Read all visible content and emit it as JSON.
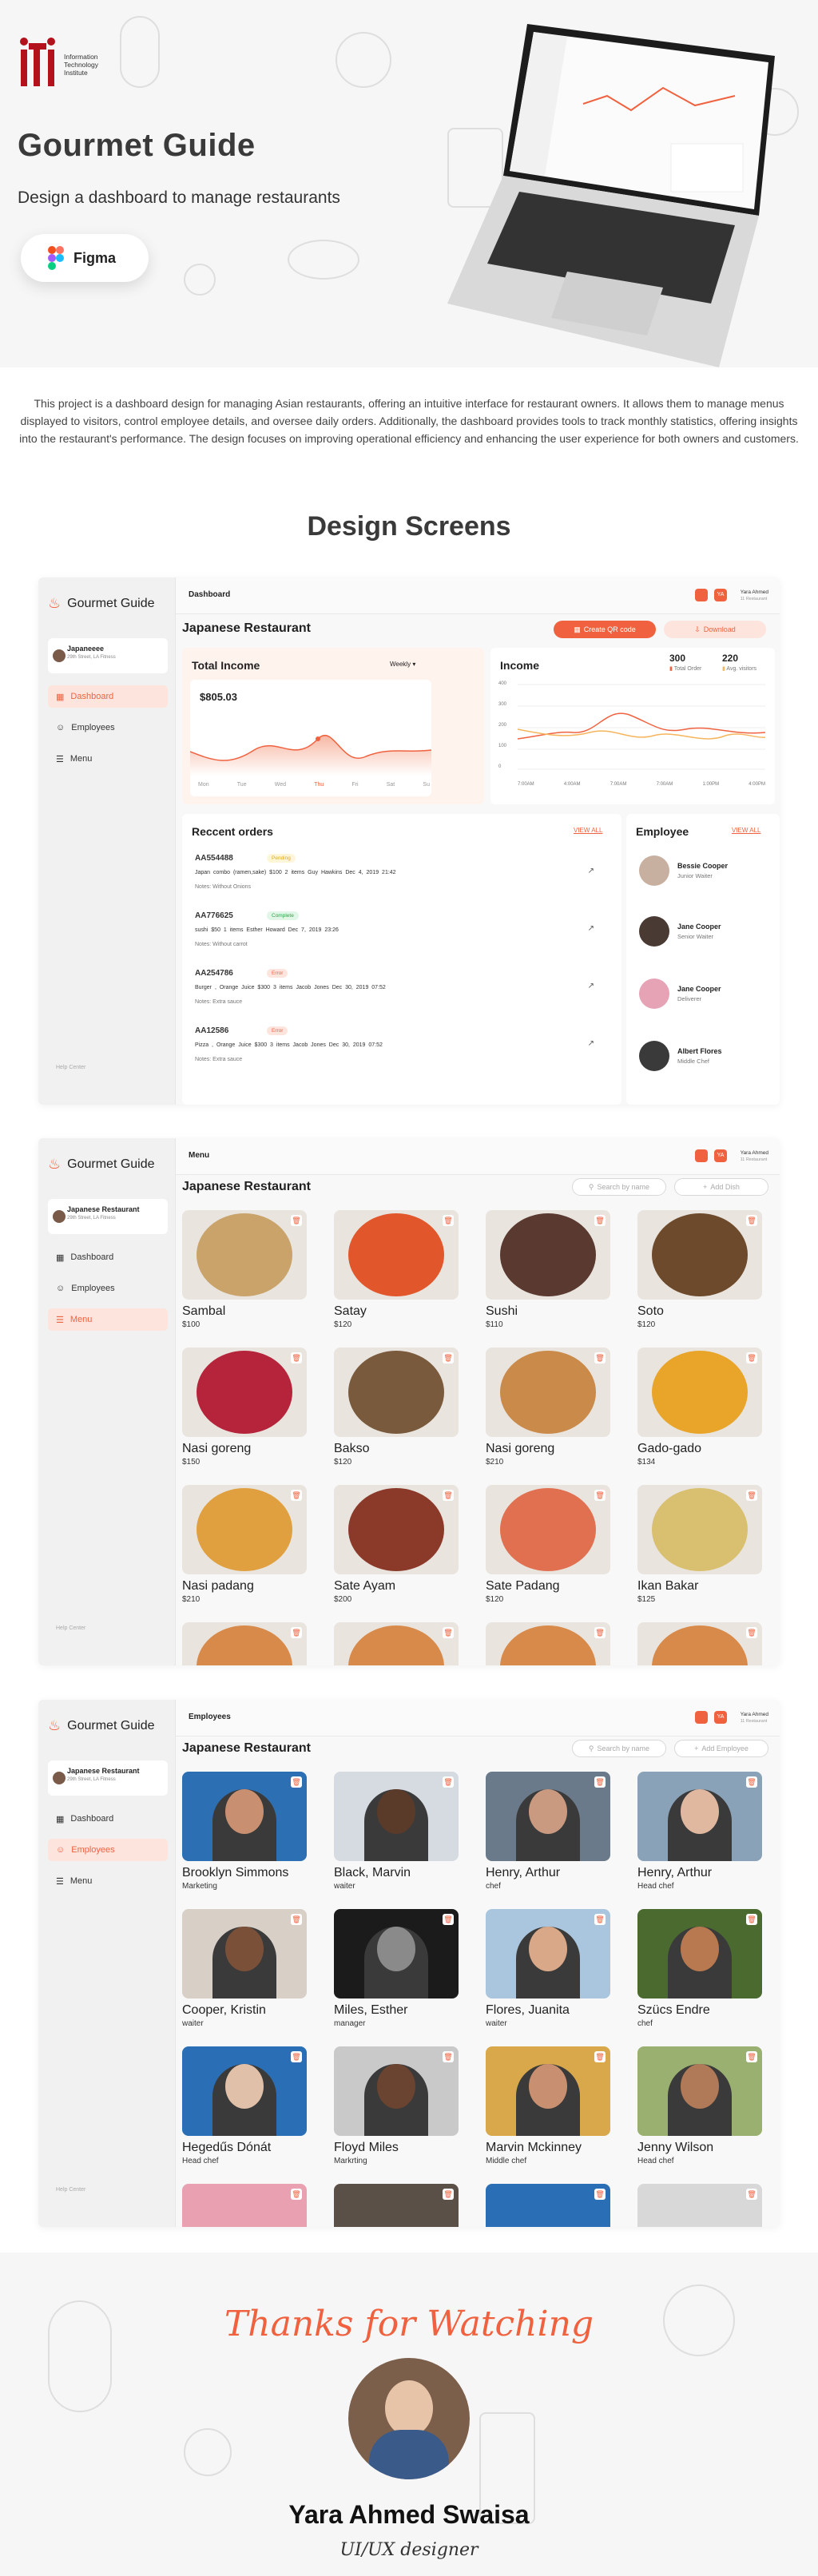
{
  "hero": {
    "logo_text": [
      "Information",
      "Technology",
      "Institute"
    ],
    "title": "Gourmet Guide",
    "subtitle": "Design a dashboard to manage restaurants",
    "tool": "Figma",
    "description": "This project is a dashboard design for managing Asian restaurants, offering an intuitive interface for restaurant owners. It allows them to manage menus displayed to visitors, control employee details, and oversee daily orders. Additionally, the dashboard provides tools to track monthly statistics, offering insights into the restaurant's performance. The design focuses on improving operational efficiency and enhancing the user experience for both owners and customers."
  },
  "section_title": "Design Screens",
  "colors": {
    "accent": "#f0623f",
    "accent_soft": "#fde4dd",
    "bg": "#f8f8f8"
  },
  "app": {
    "brand": "Gourmet Guide",
    "user": {
      "name": "Yara Ahmed",
      "sub": "11 Restaurant",
      "initials": "YA"
    },
    "help": "Help Center",
    "nav": {
      "dashboard": "Dashboard",
      "employees": "Employees",
      "menu": "Menu"
    },
    "restaurant": "Japanese Restaurant"
  },
  "dashboard": {
    "page": "Dashboard",
    "sidebar_rest": "Japaneeee",
    "sidebar_rest_sub": "29th Street, LA Fitness",
    "create_qr": "Create QR code",
    "download": "Download",
    "total_income": {
      "title": "Total Income",
      "period": "Weekly",
      "value": "$805.03",
      "days": [
        "Mon",
        "Tue",
        "Wed",
        "Thu",
        "Fri",
        "Sat",
        "Su"
      ]
    },
    "income": {
      "title": "Income",
      "total_order": "300",
      "total_order_label": "Total Order",
      "avg": "220",
      "avg_label": "Avg. visitors",
      "y_ticks": [
        "400",
        "300",
        "200",
        "100",
        "0"
      ],
      "x_ticks": [
        "7:00AM",
        "4:00AM",
        "7:00AM",
        "7:00AM",
        "1:00PM",
        "4:00PM"
      ]
    },
    "recent_orders": {
      "title": "Reccent orders",
      "view_all": "VIEW ALL",
      "items": [
        {
          "id": "AA554488",
          "status": "Pending",
          "line": "Japan combo (ramen,sake)   $100   2 items   Guy Hawkins        Dec 4, 2019 21:42",
          "note": "Notes: Without Onions"
        },
        {
          "id": "AA776625",
          "status": "Complete",
          "line": "sushi   $50   1 items   Esther Howard        Dec 7, 2019 23:26",
          "note": "Notes: Without carrot"
        },
        {
          "id": "AA254786",
          "status": "Error",
          "line": "Burger , Orange Juice   $300   3 items   Jacob Jones        Dec 30, 2019 07:52",
          "note": "Notes: Extra sauce"
        },
        {
          "id": "AA12586",
          "status": "Error",
          "line": "Pizza , Orange Juice   $300   3 items   Jacob Jones        Dec 30, 2019 07:52",
          "note": "Notes: Extra sauce"
        }
      ]
    },
    "employee": {
      "title": "Employee",
      "view_all": "VIEW ALL",
      "items": [
        {
          "name": "Bessie Cooper",
          "role": "Junior Waiter"
        },
        {
          "name": "Jane Cooper",
          "role": "Senior Waiter"
        },
        {
          "name": "Jane Cooper",
          "role": "Deliverer"
        },
        {
          "name": "Albert Flores",
          "role": "Middle Chef"
        }
      ]
    }
  },
  "menu_screen": {
    "page": "Menu",
    "sidebar_rest": "Japanese Restaurant",
    "sidebar_rest_sub": "29th Street, LA Fitness",
    "search": "Search by name",
    "add": "Add Dish",
    "dishes": [
      {
        "name": "Sambal",
        "price": "$100",
        "color": "#c9a36a"
      },
      {
        "name": "Satay",
        "price": "$120",
        "color": "#e2562b"
      },
      {
        "name": "Sushi",
        "price": "$110",
        "color": "#5a3a30"
      },
      {
        "name": "Soto",
        "price": "$120",
        "color": "#6d4a2c"
      },
      {
        "name": "Nasi goreng",
        "price": "$150",
        "color": "#b5243a"
      },
      {
        "name": "Bakso",
        "price": "$120",
        "color": "#7a5a3d"
      },
      {
        "name": "Nasi goreng",
        "price": "$210",
        "color": "#c98a4a"
      },
      {
        "name": "Gado-gado",
        "price": "$134",
        "color": "#e8a52a"
      },
      {
        "name": "Nasi padang",
        "price": "$210",
        "color": "#e0a040"
      },
      {
        "name": "Sate Ayam",
        "price": "$200",
        "color": "#8b3a2a"
      },
      {
        "name": "Sate Padang",
        "price": "$120",
        "color": "#e07050"
      },
      {
        "name": "Ikan Bakar",
        "price": "$125",
        "color": "#d9c070"
      }
    ]
  },
  "employees_screen": {
    "page": "Employees",
    "sidebar_rest": "Japanese Restaurant",
    "sidebar_rest_sub": "29th Street, LA Fitness",
    "search": "Search by name",
    "add": "Add Employee",
    "people": [
      {
        "name": "Brooklyn Simmons",
        "role": "Marketing",
        "bg": "#2d6fb3",
        "skin": "#c89070"
      },
      {
        "name": "Black, Marvin",
        "role": "waiter",
        "bg": "#d6dbe2",
        "skin": "#5a3a28"
      },
      {
        "name": "Henry, Arthur",
        "role": "chef",
        "bg": "#6b7a8a",
        "skin": "#c99a80"
      },
      {
        "name": "Henry, Arthur",
        "role": "Head chef",
        "bg": "#8aa2b8",
        "skin": "#e0b8a0"
      },
      {
        "name": "Cooper, Kristin",
        "role": "waiter",
        "bg": "#d8cfc6",
        "skin": "#7a5038"
      },
      {
        "name": "Miles, Esther",
        "role": "manager",
        "bg": "#1b1b1b",
        "skin": "#8a8a8a"
      },
      {
        "name": "Flores, Juanita",
        "role": "waiter",
        "bg": "#a9c6de",
        "skin": "#d8a888"
      },
      {
        "name": "Szücs Endre",
        "role": "chef",
        "bg": "#4a6a30",
        "skin": "#b87850"
      },
      {
        "name": "Hegedűs Dónát",
        "role": "Head chef",
        "bg": "#2a6fb5",
        "skin": "#e0c0a8"
      },
      {
        "name": "Floyd Miles",
        "role": "Markrting",
        "bg": "#c9c9c9",
        "skin": "#6a4430"
      },
      {
        "name": "Marvin Mckinney",
        "role": "Middle chef",
        "bg": "#d8a84a",
        "skin": "#c89070"
      },
      {
        "name": "Jenny Wilson",
        "role": "Head chef",
        "bg": "#9ab070",
        "skin": "#b07a58"
      }
    ]
  },
  "footer": {
    "thanks": "Thanks for Watching",
    "author": "Yara Ahmed Swaisa",
    "role": "UI/UX designer"
  }
}
